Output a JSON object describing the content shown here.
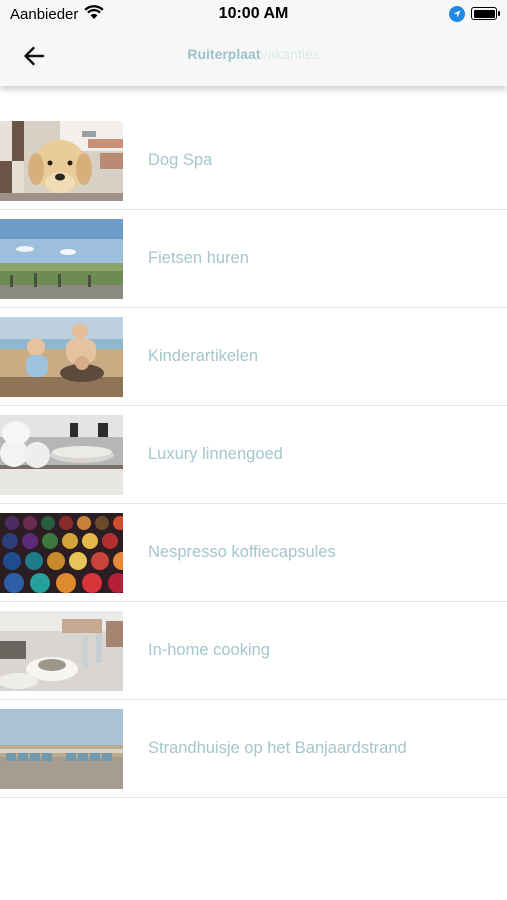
{
  "status_bar": {
    "carrier": "Aanbieder",
    "time": "10:00 AM"
  },
  "header": {
    "title_bold": "Ruiterplaat",
    "title_light": "vakanties"
  },
  "items": [
    {
      "label": "Dog Spa"
    },
    {
      "label": "Fietsen huren"
    },
    {
      "label": "Kinderartikelen"
    },
    {
      "label": "Luxury linnengoed"
    },
    {
      "label": "Nespresso koffiecapsules"
    },
    {
      "label": "In-home cooking"
    },
    {
      "label": "Strandhuisje op het Banjaardstrand"
    }
  ],
  "colors": {
    "label": "#a4c6cd",
    "title_bold": "#9cc3cc",
    "title_light": "#dbe9ec",
    "location": "#1e88e5"
  }
}
